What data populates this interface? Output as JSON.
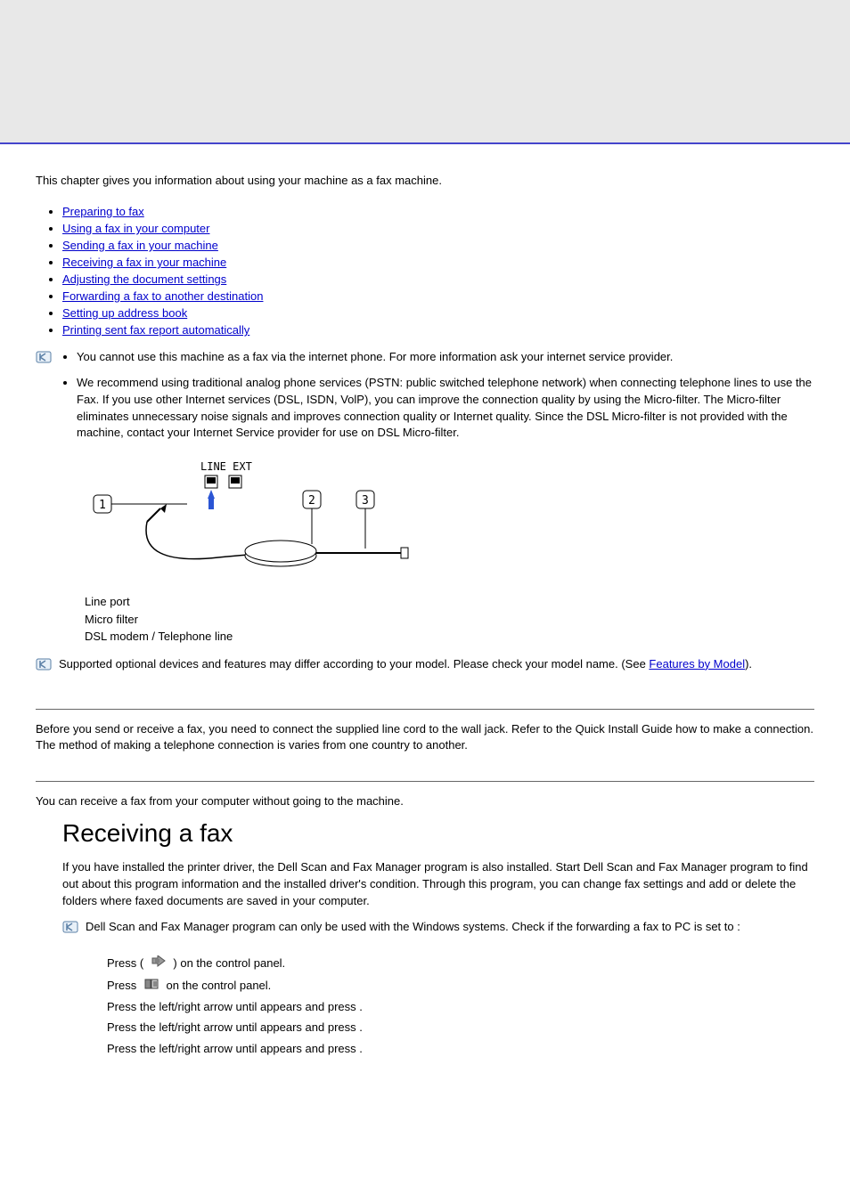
{
  "intro": "This chapter gives you information about using your machine as a fax machine.",
  "toc": [
    "Preparing to fax",
    "Using a fax in your computer",
    "Sending a fax in your machine",
    "Receiving a fax in your machine",
    "Adjusting the document settings",
    "Forwarding a fax to another destination",
    "Setting up address book",
    "Printing sent fax report automatically"
  ],
  "notes1": {
    "item1": "You cannot use this machine as a fax via the internet phone. For more information ask your internet service provider.",
    "item2": "We recommend using traditional analog phone services (PSTN: public switched telephone network) when connecting telephone lines to use the Fax. If you use other Internet services (DSL, ISDN, VolP), you can improve the connection quality by using the Micro-filter. The Micro-filter eliminates unnecessary noise signals and improves connection quality or Internet quality. Since the DSL Micro-filter is not provided with the machine, contact your Internet Service provider for use on DSL Micro-filter."
  },
  "diagram_labels": {
    "top": "LINE EXT"
  },
  "legend": {
    "l1": "Line port",
    "l2": "Micro filter",
    "l3": "DSL modem / Telephone line"
  },
  "notes2": {
    "text_a": "Supported optional devices and features may differ according to your model. Please check your model name. (See ",
    "link": "Features by Model",
    "text_b": ")."
  },
  "section_prep": "Before you send or receive a fax, you need to connect the supplied line cord to the wall jack. Refer to the Quick Install Guide how to make a connection. The method of making a telephone connection is varies from one country to another.",
  "section_use_intro": "You can receive a fax from your computer without going to the machine.",
  "heading_receiving": "Receiving a fax",
  "receiving_para": "If you have installed the printer driver, the Dell Scan and Fax Manager program is also installed. Start Dell Scan and Fax Manager program to find out about this program information and the installed driver's condition. Through this program, you can change fax settings and add or delete the folders where faxed documents are saved in your computer.",
  "notes3": {
    "text": "Dell Scan and Fax Manager program can only be used with the Windows systems. Check if the forwarding a fax to PC is set to      :"
  },
  "steps": {
    "s1a": "Press        (",
    "s1b": ") on the control panel.",
    "s2a": "Press             ",
    "s2b": " on the control panel.",
    "s3a": "Press the left/right arrow until                     appears and press      .",
    "s4a": "Press the left/right arrow until                  appears and press      .",
    "s5a": "Press the left/right arrow until        appears and press      ."
  }
}
